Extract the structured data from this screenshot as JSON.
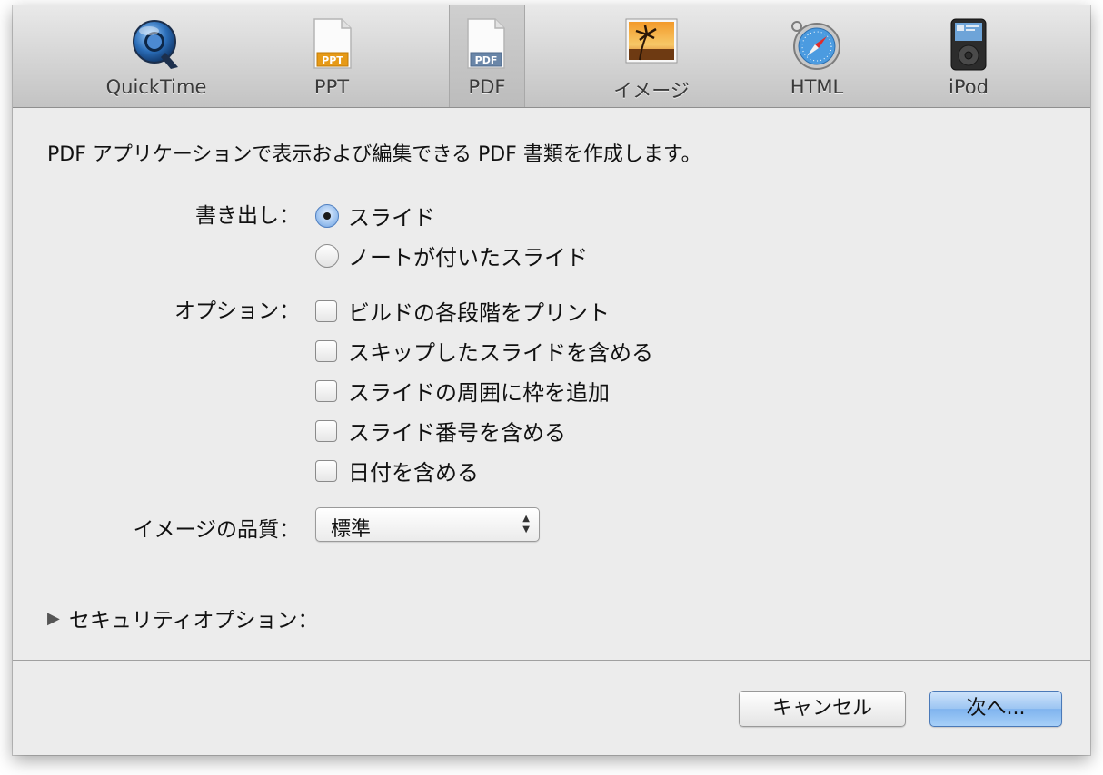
{
  "toolbar": {
    "tabs": [
      {
        "label": "QuickTime",
        "icon": "quicktime-icon"
      },
      {
        "label": "PPT",
        "icon": "ppt-document-icon"
      },
      {
        "label": "PDF",
        "icon": "pdf-document-icon",
        "selected": true
      },
      {
        "label": "イメージ",
        "icon": "image-photo-icon"
      },
      {
        "label": "HTML",
        "icon": "safari-compass-icon"
      },
      {
        "label": "iPod",
        "icon": "ipod-icon"
      }
    ],
    "ppt_badge": "PPT",
    "pdf_badge": "PDF"
  },
  "description": "PDF アプリケーションで表示および編集できる PDF 書類を作成します。",
  "export": {
    "label": "書き出し：",
    "options": [
      {
        "label": "スライド",
        "selected": true
      },
      {
        "label": "ノートが付いたスライド",
        "selected": false
      }
    ]
  },
  "options": {
    "label": "オプション：",
    "items": [
      {
        "label": "ビルドの各段階をプリント",
        "checked": false
      },
      {
        "label": "スキップしたスライドを含める",
        "checked": false
      },
      {
        "label": "スライドの周囲に枠を追加",
        "checked": false
      },
      {
        "label": "スライド番号を含める",
        "checked": false
      },
      {
        "label": "日付を含める",
        "checked": false
      }
    ]
  },
  "image_quality": {
    "label": "イメージの品質：",
    "value": "標準"
  },
  "security": {
    "label": "セキュリティオプション："
  },
  "buttons": {
    "cancel": "キャンセル",
    "next": "次へ..."
  },
  "colors": {
    "accent": "#7fb3ee",
    "window_bg": "#ececec"
  }
}
